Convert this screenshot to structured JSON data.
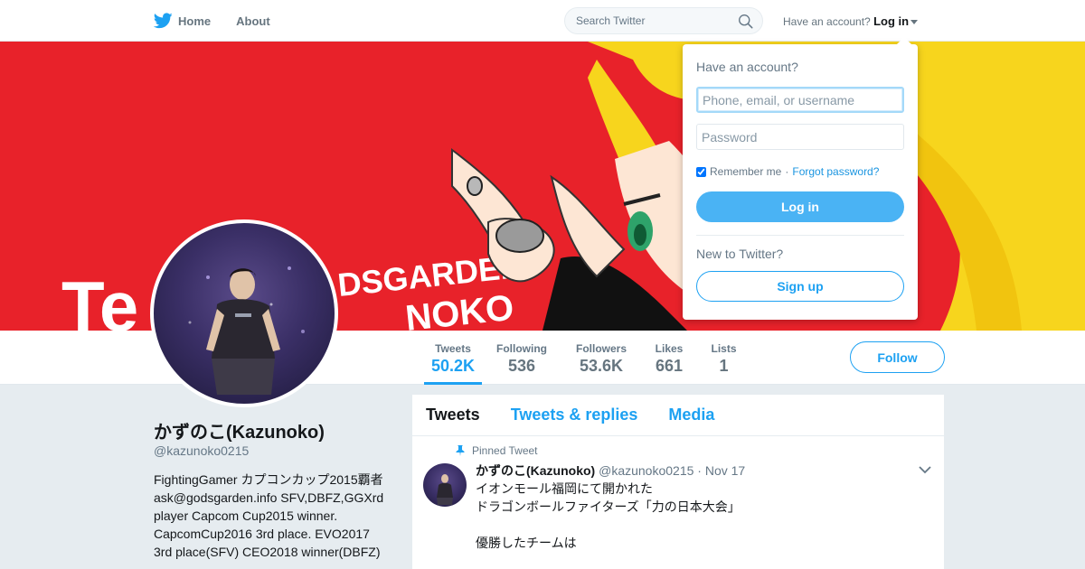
{
  "nav": {
    "home_label": "Home",
    "about_label": "About",
    "search_placeholder": "Search Twitter",
    "account_prompt": "Have an account?",
    "login_label": "Log in"
  },
  "profile": {
    "name": "かずのこ(Kazunoko)",
    "handle": "@kazunoko0215",
    "bio": "FightingGamer カプコンカップ2015覇者 ask@godsgarden.info SFV,DBFZ,GGXrd player Capcom Cup2015 winner. CapcomCup2016 3rd place. EVO2017 3rd place(SFV) CEO2018 winner(DBFZ)"
  },
  "stats": [
    {
      "label": "Tweets",
      "value": "50.2K"
    },
    {
      "label": "Following",
      "value": "536"
    },
    {
      "label": "Followers",
      "value": "53.6K"
    },
    {
      "label": "Likes",
      "value": "661"
    },
    {
      "label": "Lists",
      "value": "1"
    }
  ],
  "follow_label": "Follow",
  "banner": {
    "text_left": "Te",
    "text_mid": "DSGARDEN",
    "text_low": "NOKO"
  },
  "timeline": {
    "tabs": [
      "Tweets",
      "Tweets & replies",
      "Media"
    ],
    "pinned_label": "Pinned Tweet",
    "tweet": {
      "name": "かずのこ(Kazunoko)",
      "handle": "@kazunoko0215",
      "date": "· Nov 17",
      "text": "イオンモール福岡にて開かれた\nドラゴンボールファイターズ「力の日本大会」\n\n優勝したチームは"
    }
  },
  "login_dropdown": {
    "title": "Have an account?",
    "username_placeholder": "Phone, email, or username",
    "password_placeholder": "Password",
    "remember_label": "Remember me",
    "separator": "·",
    "forgot_label": "Forgot password?",
    "login_button": "Log in",
    "new_prompt": "New to Twitter?",
    "signup_button": "Sign up"
  },
  "colors": {
    "accent": "#1da1f2",
    "banner_red": "#e8222a",
    "login_button": "#4ab3f4"
  }
}
